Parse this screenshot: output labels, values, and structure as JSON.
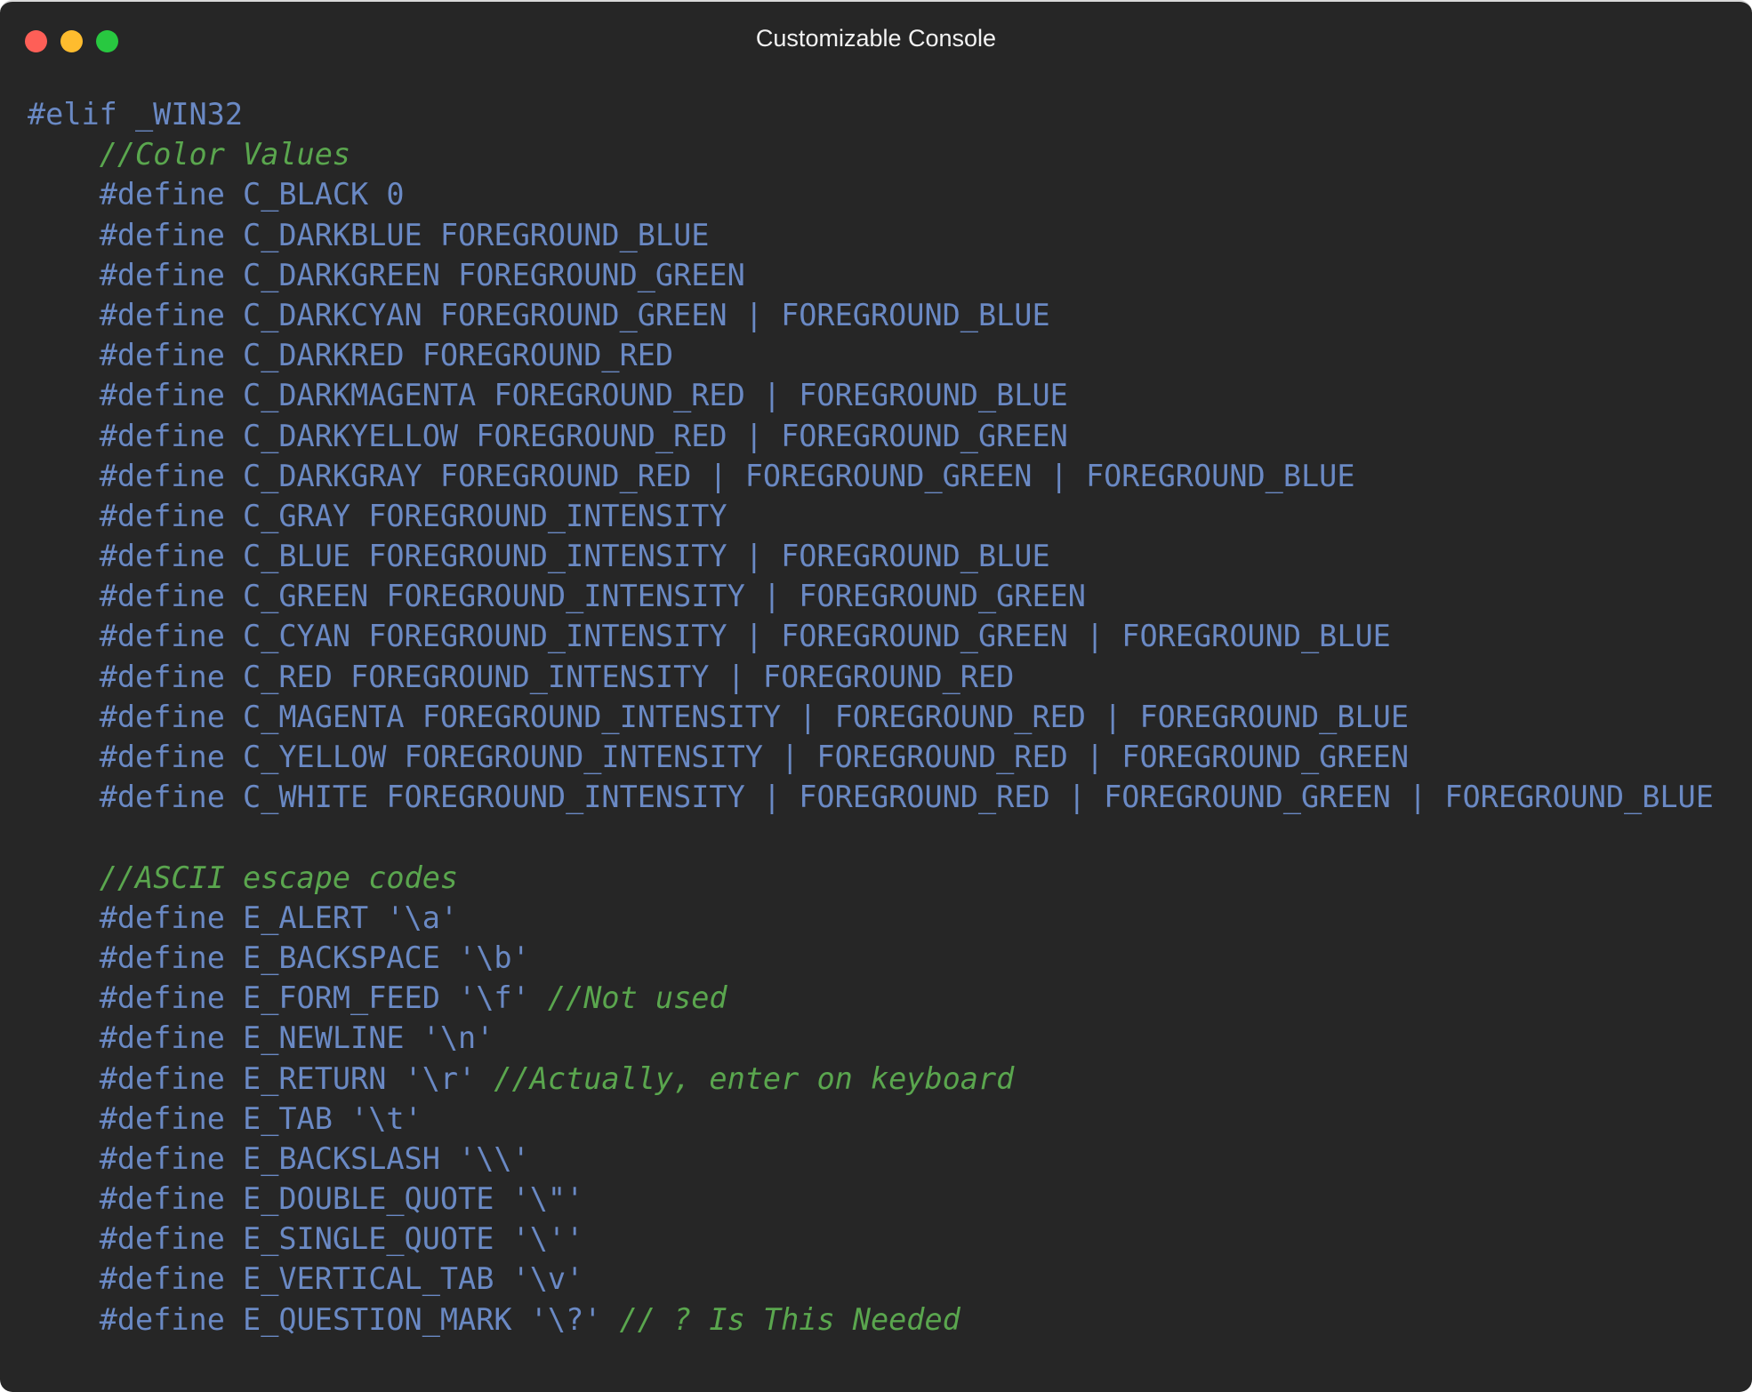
{
  "window": {
    "title": "Customizable Console",
    "controls": {
      "close": "close-button",
      "minimize": "minimize-button",
      "maximize": "maximize-button"
    }
  },
  "colors": {
    "background": "#262626",
    "code_text": "#6a89c4",
    "comment": "#5aa64e",
    "title_text": "#f2f2f2",
    "close": "#fe5f57",
    "minimize": "#febc2e",
    "maximize": "#28c840"
  },
  "code_lines": [
    {
      "indent": 0,
      "code": "#elif _WIN32",
      "comment": ""
    },
    {
      "indent": 1,
      "code": "",
      "comment": "//Color Values"
    },
    {
      "indent": 1,
      "code": "#define C_BLACK 0",
      "comment": ""
    },
    {
      "indent": 1,
      "code": "#define C_DARKBLUE FOREGROUND_BLUE",
      "comment": ""
    },
    {
      "indent": 1,
      "code": "#define C_DARKGREEN FOREGROUND_GREEN",
      "comment": ""
    },
    {
      "indent": 1,
      "code": "#define C_DARKCYAN FOREGROUND_GREEN | FOREGROUND_BLUE",
      "comment": ""
    },
    {
      "indent": 1,
      "code": "#define C_DARKRED FOREGROUND_RED",
      "comment": ""
    },
    {
      "indent": 1,
      "code": "#define C_DARKMAGENTA FOREGROUND_RED | FOREGROUND_BLUE",
      "comment": ""
    },
    {
      "indent": 1,
      "code": "#define C_DARKYELLOW FOREGROUND_RED | FOREGROUND_GREEN",
      "comment": ""
    },
    {
      "indent": 1,
      "code": "#define C_DARKGRAY FOREGROUND_RED | FOREGROUND_GREEN | FOREGROUND_BLUE",
      "comment": ""
    },
    {
      "indent": 1,
      "code": "#define C_GRAY FOREGROUND_INTENSITY",
      "comment": ""
    },
    {
      "indent": 1,
      "code": "#define C_BLUE FOREGROUND_INTENSITY | FOREGROUND_BLUE",
      "comment": ""
    },
    {
      "indent": 1,
      "code": "#define C_GREEN FOREGROUND_INTENSITY | FOREGROUND_GREEN",
      "comment": ""
    },
    {
      "indent": 1,
      "code": "#define C_CYAN FOREGROUND_INTENSITY | FOREGROUND_GREEN | FOREGROUND_BLUE",
      "comment": ""
    },
    {
      "indent": 1,
      "code": "#define C_RED FOREGROUND_INTENSITY | FOREGROUND_RED",
      "comment": ""
    },
    {
      "indent": 1,
      "code": "#define C_MAGENTA FOREGROUND_INTENSITY | FOREGROUND_RED | FOREGROUND_BLUE",
      "comment": ""
    },
    {
      "indent": 1,
      "code": "#define C_YELLOW FOREGROUND_INTENSITY | FOREGROUND_RED | FOREGROUND_GREEN",
      "comment": ""
    },
    {
      "indent": 1,
      "code": "#define C_WHITE FOREGROUND_INTENSITY | FOREGROUND_RED | FOREGROUND_GREEN | FOREGROUND_BLUE",
      "comment": ""
    },
    {
      "indent": 0,
      "code": "",
      "comment": ""
    },
    {
      "indent": 1,
      "code": "",
      "comment": "//ASCII escape codes"
    },
    {
      "indent": 1,
      "code": "#define E_ALERT '\\a'",
      "comment": ""
    },
    {
      "indent": 1,
      "code": "#define E_BACKSPACE '\\b'",
      "comment": ""
    },
    {
      "indent": 1,
      "code": "#define E_FORM_FEED '\\f' ",
      "comment": "//Not used"
    },
    {
      "indent": 1,
      "code": "#define E_NEWLINE '\\n'",
      "comment": ""
    },
    {
      "indent": 1,
      "code": "#define E_RETURN '\\r' ",
      "comment": "//Actually, enter on keyboard"
    },
    {
      "indent": 1,
      "code": "#define E_TAB '\\t'",
      "comment": ""
    },
    {
      "indent": 1,
      "code": "#define E_BACKSLASH '\\\\'",
      "comment": ""
    },
    {
      "indent": 1,
      "code": "#define E_DOUBLE_QUOTE '\\\"'",
      "comment": ""
    },
    {
      "indent": 1,
      "code": "#define E_SINGLE_QUOTE '\\''",
      "comment": ""
    },
    {
      "indent": 1,
      "code": "#define E_VERTICAL_TAB '\\v'",
      "comment": ""
    },
    {
      "indent": 1,
      "code": "#define E_QUESTION_MARK '\\?' ",
      "comment": "// ? Is This Needed"
    }
  ]
}
